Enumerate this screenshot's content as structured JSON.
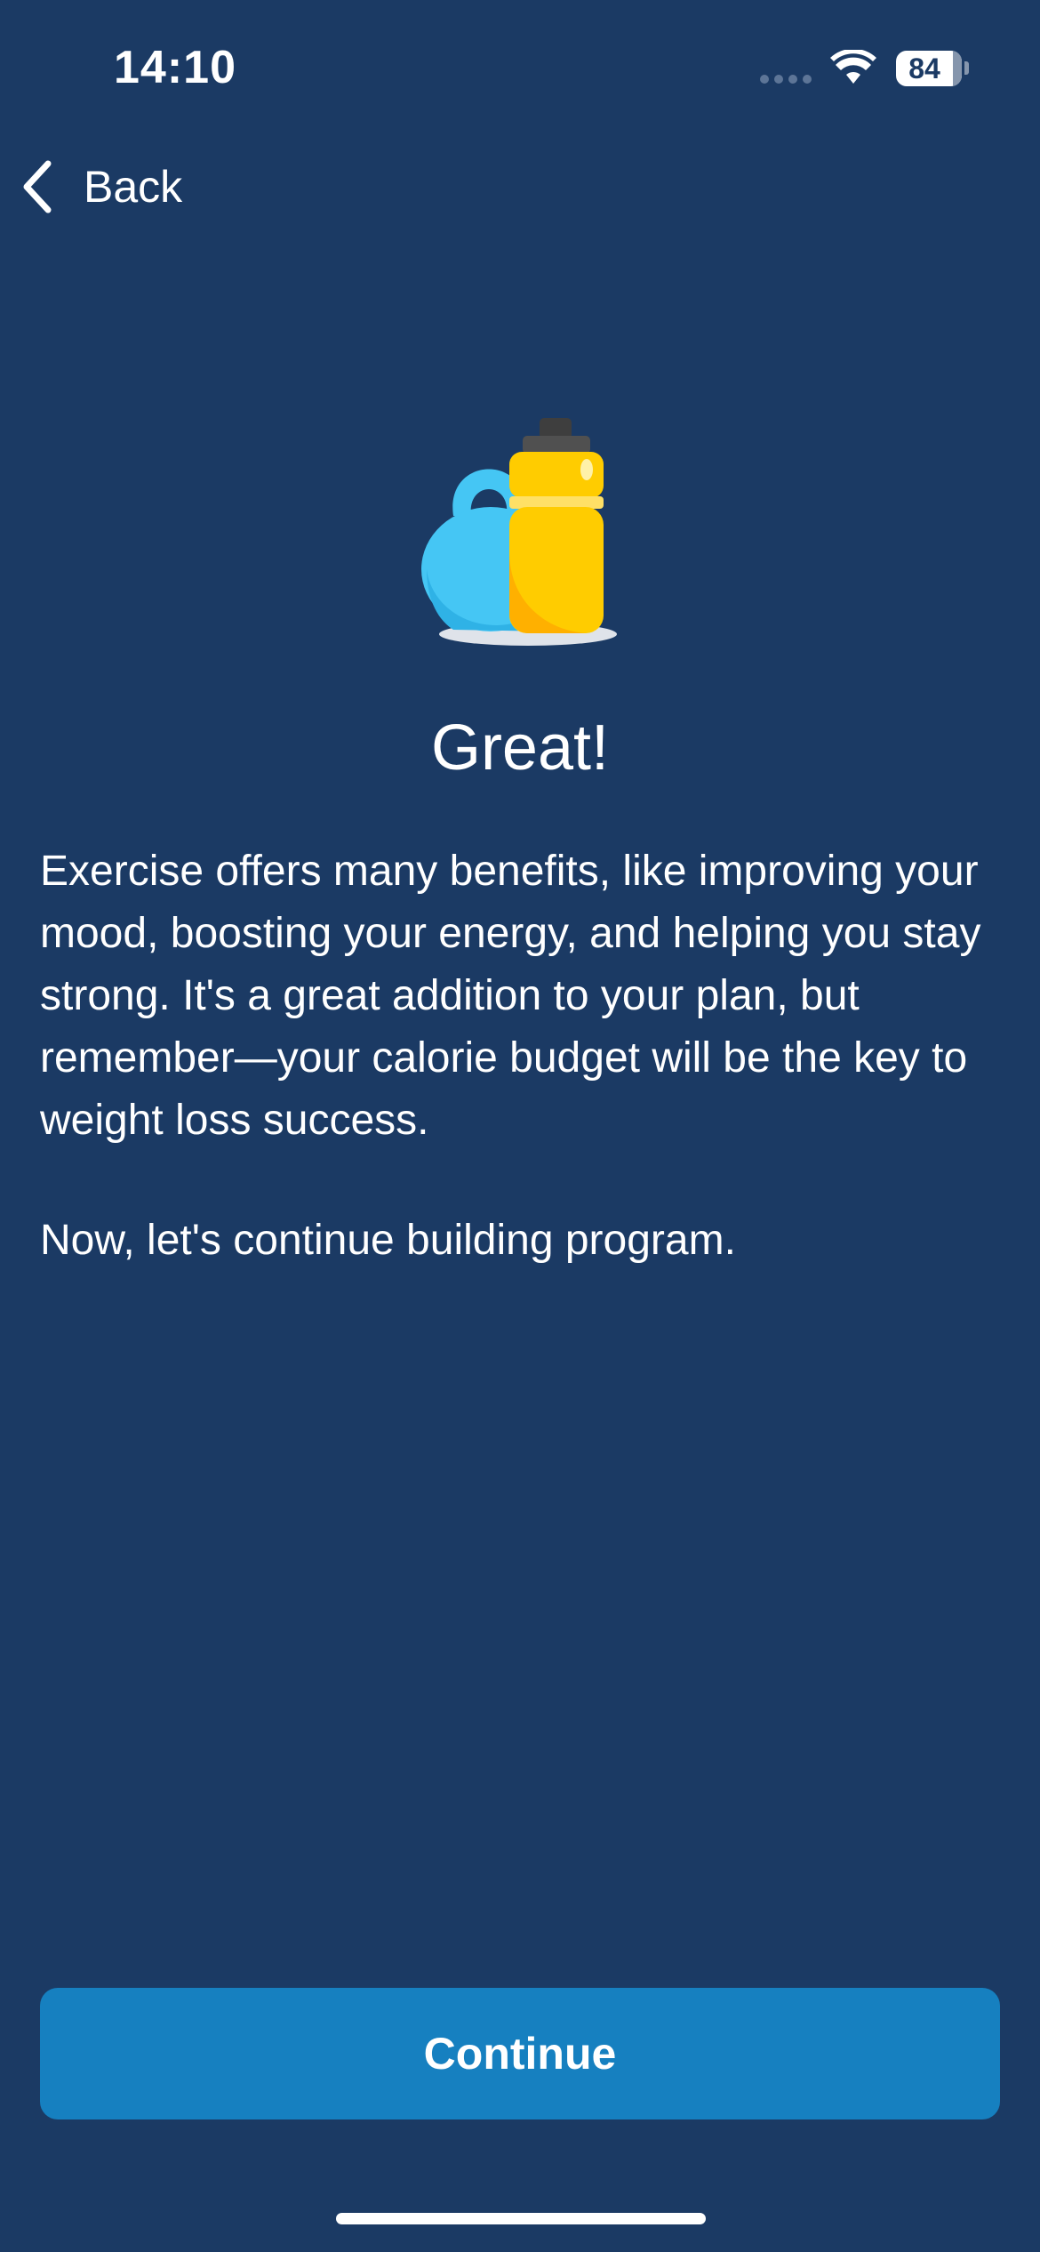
{
  "status_bar": {
    "time": "14:10",
    "battery": "84"
  },
  "nav": {
    "back_label": "Back"
  },
  "content": {
    "title": "Great!",
    "paragraph_1": "Exercise offers many benefits, like improving your mood, boosting your energy, and helping you stay strong. It's a great addition to your plan, but remember—your calorie budget will be the key to weight loss success.",
    "paragraph_2": "Now, let's continue building program."
  },
  "footer": {
    "continue_label": "Continue"
  },
  "icons": {
    "back": "chevron-left-icon",
    "wifi": "wifi-icon",
    "illustration": "kettlebell-water-bottle-illustration"
  },
  "colors": {
    "background": "#1b3a64",
    "button": "#1680c0",
    "text": "#ffffff",
    "kettlebell": "#3fc3f2",
    "bottle": "#ffcc00"
  }
}
